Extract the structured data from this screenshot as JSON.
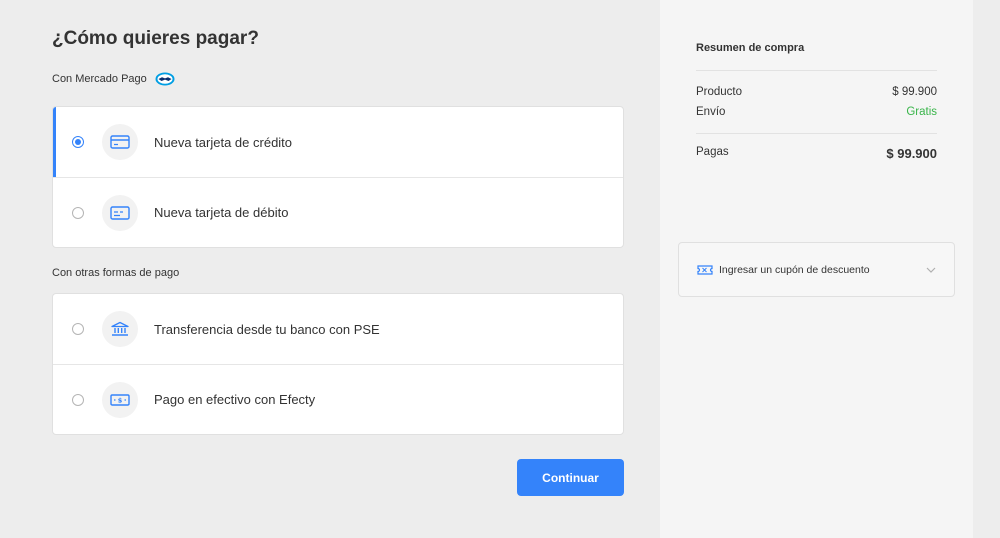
{
  "main": {
    "title": "¿Cómo quieres pagar?",
    "section_mp": {
      "label": "Con Mercado Pago",
      "logo_icon": "mercado-pago-handshake-icon"
    },
    "mp_options": [
      {
        "label": "Nueva tarjeta de crédito",
        "icon": "credit-card-icon",
        "selected": true
      },
      {
        "label": "Nueva tarjeta de débito",
        "icon": "debit-card-icon",
        "selected": false
      }
    ],
    "section_other": {
      "label": "Con otras formas de pago"
    },
    "other_options": [
      {
        "label": "Transferencia desde tu banco con PSE",
        "icon": "bank-icon",
        "selected": false
      },
      {
        "label": "Pago en efectivo con Efecty",
        "icon": "cash-icon",
        "selected": false
      }
    ],
    "continue_label": "Continuar"
  },
  "summary": {
    "title": "Resumen de compra",
    "product_label": "Producto",
    "product_value": "$ 99.900",
    "shipping_label": "Envío",
    "shipping_value": "Gratis",
    "total_label": "Pagas",
    "total_value": "$ 99.900"
  },
  "coupon": {
    "label": "Ingresar un cupón de descuento",
    "icon": "ticket-icon",
    "chevron_icon": "chevron-down-icon"
  },
  "colors": {
    "accent": "#3483fa",
    "free": "#39b54a",
    "background": "#ededed",
    "sidebar": "#f5f5f5"
  }
}
